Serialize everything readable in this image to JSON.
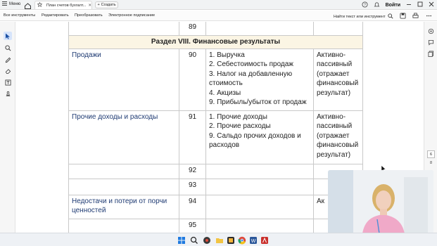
{
  "tabbar": {
    "menu_label": "Меню",
    "tab_title": "План счетов бухгалт...",
    "new_tab_label": "Создать",
    "login_label": "Войти"
  },
  "toolbar": {
    "items": [
      "Все инструменты",
      "Редактировать",
      "Преобразовать",
      "Электронное подписание"
    ],
    "search_label": "Найти текст или инструмент"
  },
  "pager": {
    "current": "6",
    "total": "8"
  },
  "table": {
    "rows": [
      {
        "name": "",
        "num": "89",
        "subs": [],
        "type": []
      },
      {
        "section": "Раздел VIII. Финансовые результаты"
      },
      {
        "name": "Продажи",
        "num": "90",
        "subs": [
          "1. Выручка",
          "2. Себестоимость продаж",
          "3. Налог на добавленную стоимость",
          "4. Акцизы",
          "9. Прибыль/убыток от продаж"
        ],
        "type": [
          "Активно-",
          "пассивный",
          "(отражает",
          "финансовый",
          "результат)"
        ]
      },
      {
        "name": "Прочие доходы и расходы",
        "num": "91",
        "subs": [
          "1. Прочие доходы",
          "2. Прочие расходы",
          "9. Сальдо прочих доходов и расходов"
        ],
        "type": [
          "Активно-",
          "пассивный",
          "(отражает",
          "финансовый",
          "результат)"
        ]
      },
      {
        "name": "",
        "num": "92",
        "subs": [],
        "type": []
      },
      {
        "name": "",
        "num": "93",
        "subs": [],
        "type": []
      },
      {
        "name": "Недостачи и потери от порчи ценностей",
        "num": "94",
        "subs": [],
        "type": [
          "Ак"
        ]
      },
      {
        "name": "",
        "num": "95",
        "subs": [],
        "type": []
      }
    ]
  },
  "colors": {
    "section_bg": "#fbf5e4",
    "name_text": "#1f3b73",
    "accent": "#1a73e8"
  }
}
